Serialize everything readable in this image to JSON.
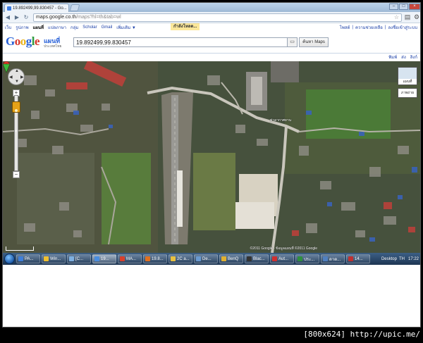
{
  "browser": {
    "tab_title": "19.892499,99.830457 - Go...",
    "tab_close": "×",
    "window_controls": [
      "–",
      "□",
      "×"
    ],
    "url_host": "maps.google.co.th",
    "url_path": "/maps?hl=th&tab=wl",
    "nav_icons": [
      "back-icon",
      "forward-icon",
      "reload-icon",
      "star-icon",
      "page-icon",
      "wrench-icon"
    ]
  },
  "gbar": {
    "items": [
      "เว็บ",
      "รูปภาพ",
      "แผนที่",
      "แปลภาษา",
      "กลุ่ม",
      "Scholar",
      "Gmail",
      "เพิ่มเติม ▼"
    ],
    "active_index": 2,
    "loading_text": "กำลังโหลด...",
    "right_items": [
      "โพสต์",
      "|",
      "ความช่วยเหลือ",
      "|",
      "ลงชื่อเข้าสู่ระบบ"
    ]
  },
  "search": {
    "logo_letters": [
      "G",
      "o",
      "o",
      "g",
      "l",
      "e"
    ],
    "logo_sub": "แผนที่",
    "logo_sub2": "ประเทศไทย",
    "query": "19.892499,99.830457",
    "keyboard_icon": "▭",
    "button_label": "ค้นหา Maps"
  },
  "map_toolbar": {
    "items": [
      "พิมพ์",
      "ส่ง",
      "ลิงก์"
    ]
  },
  "map": {
    "pan_symbols": [
      "▲",
      "◀",
      "▶",
      "▼"
    ],
    "zoom_in": "+",
    "zoom_out": "−",
    "type_map_label": "แผนที่",
    "type_sat_label": "ภาพถ่าย",
    "place_label": "ท่าอากาศยาน",
    "copyright": "©2011 Google - ข้อมูลแผนที่ ©2011 Google"
  },
  "taskbar": {
    "tasks": [
      {
        "label": "PA...",
        "color": "#3f7fd9"
      },
      {
        "label": "Win...",
        "color": "#f0c030"
      },
      {
        "label": "[C...",
        "color": "#7fb0e0"
      },
      {
        "label": "19...",
        "color": "#4a8ee0",
        "active": true
      },
      {
        "label": "MA...",
        "color": "#d8402c"
      },
      {
        "label": "19.8...",
        "color": "#e07020"
      },
      {
        "label": "2C a...",
        "color": "#e8c040"
      },
      {
        "label": "De...",
        "color": "#6a9ad0"
      },
      {
        "label": "BenQ",
        "color": "#e0b030"
      },
      {
        "label": "Blac...",
        "color": "#333333"
      },
      {
        "label": "Aut...",
        "color": "#d03030"
      },
      {
        "label": "ประ...",
        "color": "#2f8f3f"
      },
      {
        "label": "ดาต...",
        "color": "#5080c0"
      },
      {
        "label": "14...",
        "color": "#c03030"
      }
    ],
    "desktop_label": "Desktop",
    "lang": "TH",
    "clock": "17:22"
  },
  "watermark": "[800x624] http://upic.me/"
}
